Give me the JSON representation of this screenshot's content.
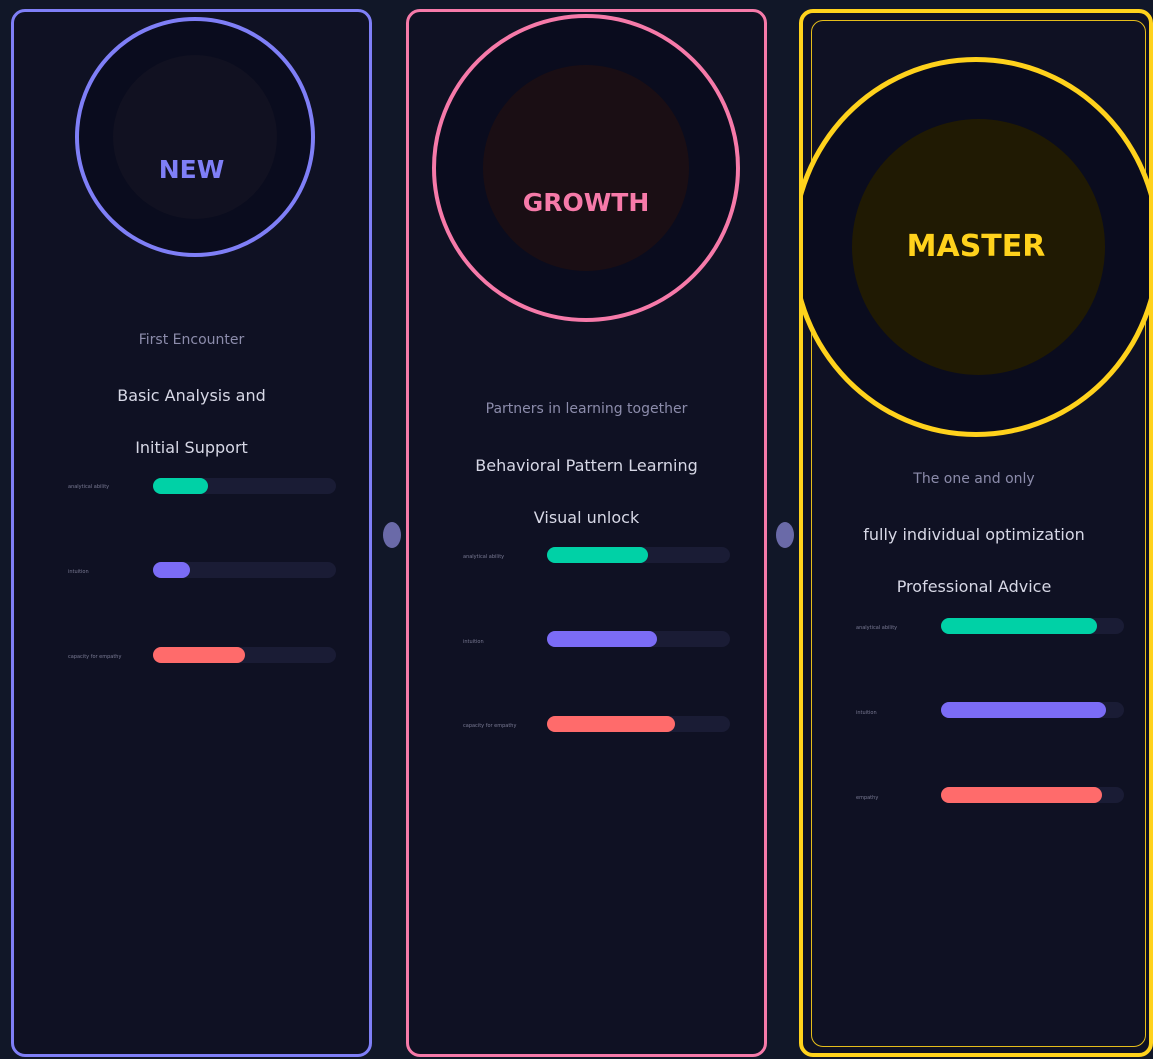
{
  "colors": {
    "background": "#111728",
    "card": "#0f1123",
    "new": "#7f7ff7",
    "growth": "#f67aa9",
    "master": "#ffd21c",
    "analytical": "#00d1a6",
    "intuition": "#7b6cf6",
    "empathy": "#ff6b6b",
    "track": "#1a1c35"
  },
  "tiers": [
    {
      "label": "NEW",
      "tagline": "First Encounter",
      "features": [
        "Basic Analysis and",
        "Initial Support"
      ],
      "stats": [
        {
          "label": "analytical ability",
          "value": 0.3
        },
        {
          "label": "intuition",
          "value": 0.2
        },
        {
          "label": "capacity for empathy",
          "value": 0.5
        }
      ]
    },
    {
      "label": "GROWTH",
      "tagline": "Partners in learning together",
      "features": [
        "Behavioral Pattern Learning",
        "Visual unlock"
      ],
      "stats": [
        {
          "label": "analytical ability",
          "value": 0.55
        },
        {
          "label": "intuition",
          "value": 0.6
        },
        {
          "label": "capacity for empathy",
          "value": 0.7
        }
      ]
    },
    {
      "label": "MASTER",
      "tagline": "The one and only",
      "features": [
        "fully individual optimization",
        "Professional Advice"
      ],
      "stats": [
        {
          "label": "analytical ability",
          "value": 0.85
        },
        {
          "label": "intuition",
          "value": 0.9
        },
        {
          "label": "empathy",
          "value": 0.88
        }
      ]
    }
  ]
}
